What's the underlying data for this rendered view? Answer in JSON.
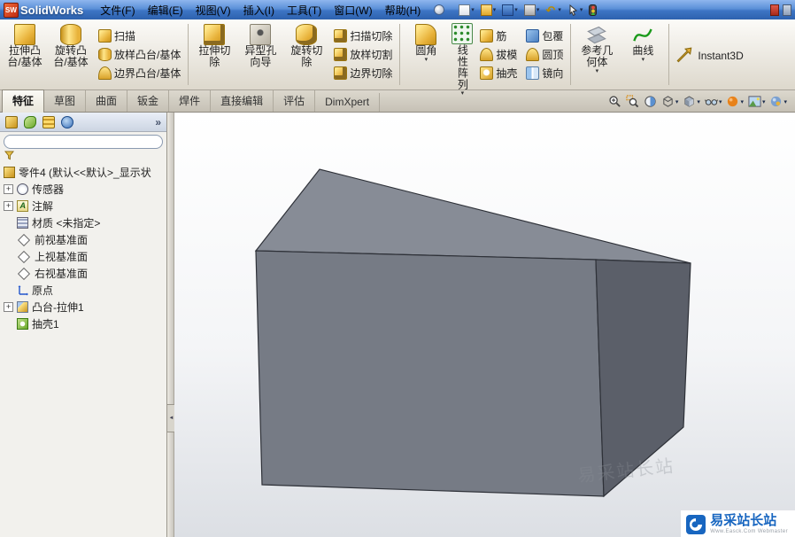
{
  "icons": {
    "dropdown": "▾",
    "chevron": "»",
    "collapse": "◄",
    "expand": "+"
  },
  "titlebar": {
    "logo_badge": "SW",
    "app_name": "SolidWorks",
    "menus": [
      "文件(F)",
      "编辑(E)",
      "视图(V)",
      "插入(I)",
      "工具(T)",
      "窗口(W)",
      "帮助(H)"
    ]
  },
  "ribbon": {
    "buttons": {
      "extrude_boss": {
        "l1": "拉伸凸",
        "l2": "台/基体"
      },
      "revolve_boss": {
        "l1": "旋转凸",
        "l2": "台/基体"
      },
      "sweep": "扫描",
      "loft": "放样凸台/基体",
      "boundary": "边界凸台/基体",
      "extruded_cut": {
        "l1": "拉伸切",
        "l2": "除"
      },
      "hole_wizard": {
        "l1": "异型孔",
        "l2": "向导"
      },
      "revolved_cut": {
        "l1": "旋转切",
        "l2": "除"
      },
      "swept_cut": "扫描切除",
      "lofted_cut": "放样切割",
      "boundary_cut": "边界切除",
      "fillet": "圆角",
      "linear_pattern": "线性阵列",
      "rib": "筋",
      "draft": "拔模",
      "shell": "抽壳",
      "wrap": "包覆",
      "dome": "圆顶",
      "mirror": "镜向",
      "reference_geometry": {
        "l1": "参考几",
        "l2": "何体"
      },
      "curves": "曲线",
      "instant3d": "Instant3D"
    }
  },
  "tabs": [
    "特征",
    "草图",
    "曲面",
    "钣金",
    "焊件",
    "直接编辑",
    "评估",
    "DimXpert"
  ],
  "tree": {
    "root": "零件4 (默认<<默认>_显示状",
    "items": [
      {
        "label": "传感器"
      },
      {
        "label": "注解"
      },
      {
        "label": "材质 <未指定>"
      },
      {
        "label": "前视基准面"
      },
      {
        "label": "上视基准面"
      },
      {
        "label": "右视基准面"
      },
      {
        "label": "原点"
      },
      {
        "label": "凸台-拉伸1"
      },
      {
        "label": "抽壳1"
      }
    ]
  },
  "model": {
    "colors": {
      "top": "#878c96",
      "front": "#767b85",
      "side": "#5b5f69"
    }
  },
  "watermark": {
    "faint": "易采站长站",
    "brand": "易采站长站",
    "sub": "Www.Easck.Com Webmaster"
  }
}
